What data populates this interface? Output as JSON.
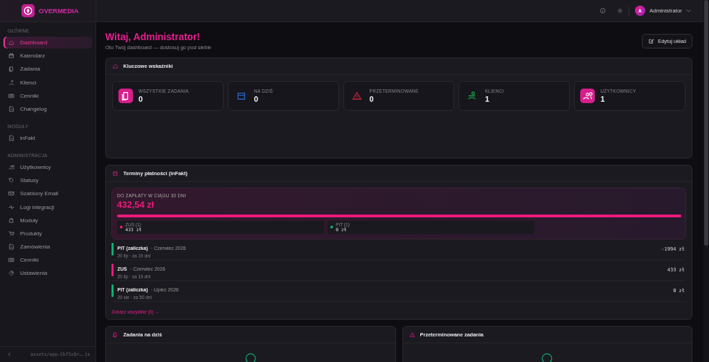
{
  "brand": {
    "name": "OVERMEDIA"
  },
  "sidebar": {
    "sections": [
      {
        "title": "GŁÓWNE",
        "items": [
          {
            "label": "Dashboard",
            "selected": true
          },
          {
            "label": "Kalendarz",
            "selected": false
          },
          {
            "label": "Zadania",
            "selected": false
          },
          {
            "label": "Klienci",
            "selected": false
          },
          {
            "label": "Cenniki",
            "selected": false
          },
          {
            "label": "Changelog",
            "selected": false
          }
        ]
      },
      {
        "title": "MODUŁY",
        "items": [
          {
            "label": "inFakt",
            "selected": false
          }
        ]
      },
      {
        "title": "ADMINISTRACJA",
        "items": [
          {
            "label": "Użytkownicy",
            "selected": false
          },
          {
            "label": "Statusy",
            "selected": false
          },
          {
            "label": "Szablony Email",
            "selected": false
          },
          {
            "label": "Logi integracji",
            "selected": false
          },
          {
            "label": "Moduły",
            "selected": false
          },
          {
            "label": "Produkty",
            "selected": false
          },
          {
            "label": "Zamówienia",
            "selected": false
          },
          {
            "label": "Cenniki",
            "selected": false
          },
          {
            "label": "Ustawienia",
            "selected": false
          }
        ]
      }
    ],
    "footer": "assets/app-CkfSxQr….js"
  },
  "header": {
    "user": {
      "initial": "A",
      "name": "Administrator"
    }
  },
  "page": {
    "title": "Witaj, Administrator!",
    "subtitle": "Oto Twój dashboard — dostosuj go pod siebie",
    "edit_button": "Edytuj układ"
  },
  "kpi_panel": {
    "title": "Kluczowe wskaźniki",
    "cards": [
      {
        "label": "WSZYSTKIE ZADANIA",
        "value": "0",
        "kind": "tile",
        "color": "#d61f8c"
      },
      {
        "label": "NA DZIŚ",
        "value": "0",
        "kind": "plain",
        "color": "#2563c9"
      },
      {
        "label": "PRZETERMINOWANE",
        "value": "0",
        "kind": "plain",
        "color": "#c0283a"
      },
      {
        "label": "KLIENCI",
        "value": "1",
        "kind": "plain",
        "color": "#17a04a"
      },
      {
        "label": "UŻYTKOWNICY",
        "value": "1",
        "kind": "tile",
        "color": "#d61f8c"
      }
    ]
  },
  "payments_panel": {
    "title": "Terminy płatności (inFakt)",
    "summary": {
      "label": "DO ZAPŁATY W CIĄGU 30 DNI",
      "amount": "432,54 zł",
      "level": 1,
      "breakdown": [
        {
          "label": "ZUS (1)",
          "value": "433 zł",
          "color": "#f0197d"
        },
        {
          "label": "PIT (1)",
          "value": "0 zł",
          "color": "#10b070"
        }
      ]
    },
    "rows": [
      {
        "name": "PIT (zaliczka)",
        "period": "· Czerwiec 2026",
        "due": "20 lip · za 19 dni",
        "amount": "-1994 zł",
        "color": "#10b070"
      },
      {
        "name": "ZUS",
        "period": "· Czerwiec 2026",
        "due": "20 lip · za 19 dni",
        "amount": "433 zł",
        "color": "#f0197d"
      },
      {
        "name": "PIT (zaliczka)",
        "period": "· Lipiec 2026",
        "due": "20 sie · za 50 dni",
        "amount": "0 zł",
        "color": "#10b070"
      }
    ],
    "link": "Zobacz wszystkie (6) →"
  },
  "bottom_panels": [
    {
      "title": "Zadania na dziś",
      "kind": "tasks"
    },
    {
      "title": "Przeterminowane zadania",
      "kind": "warning"
    }
  ]
}
